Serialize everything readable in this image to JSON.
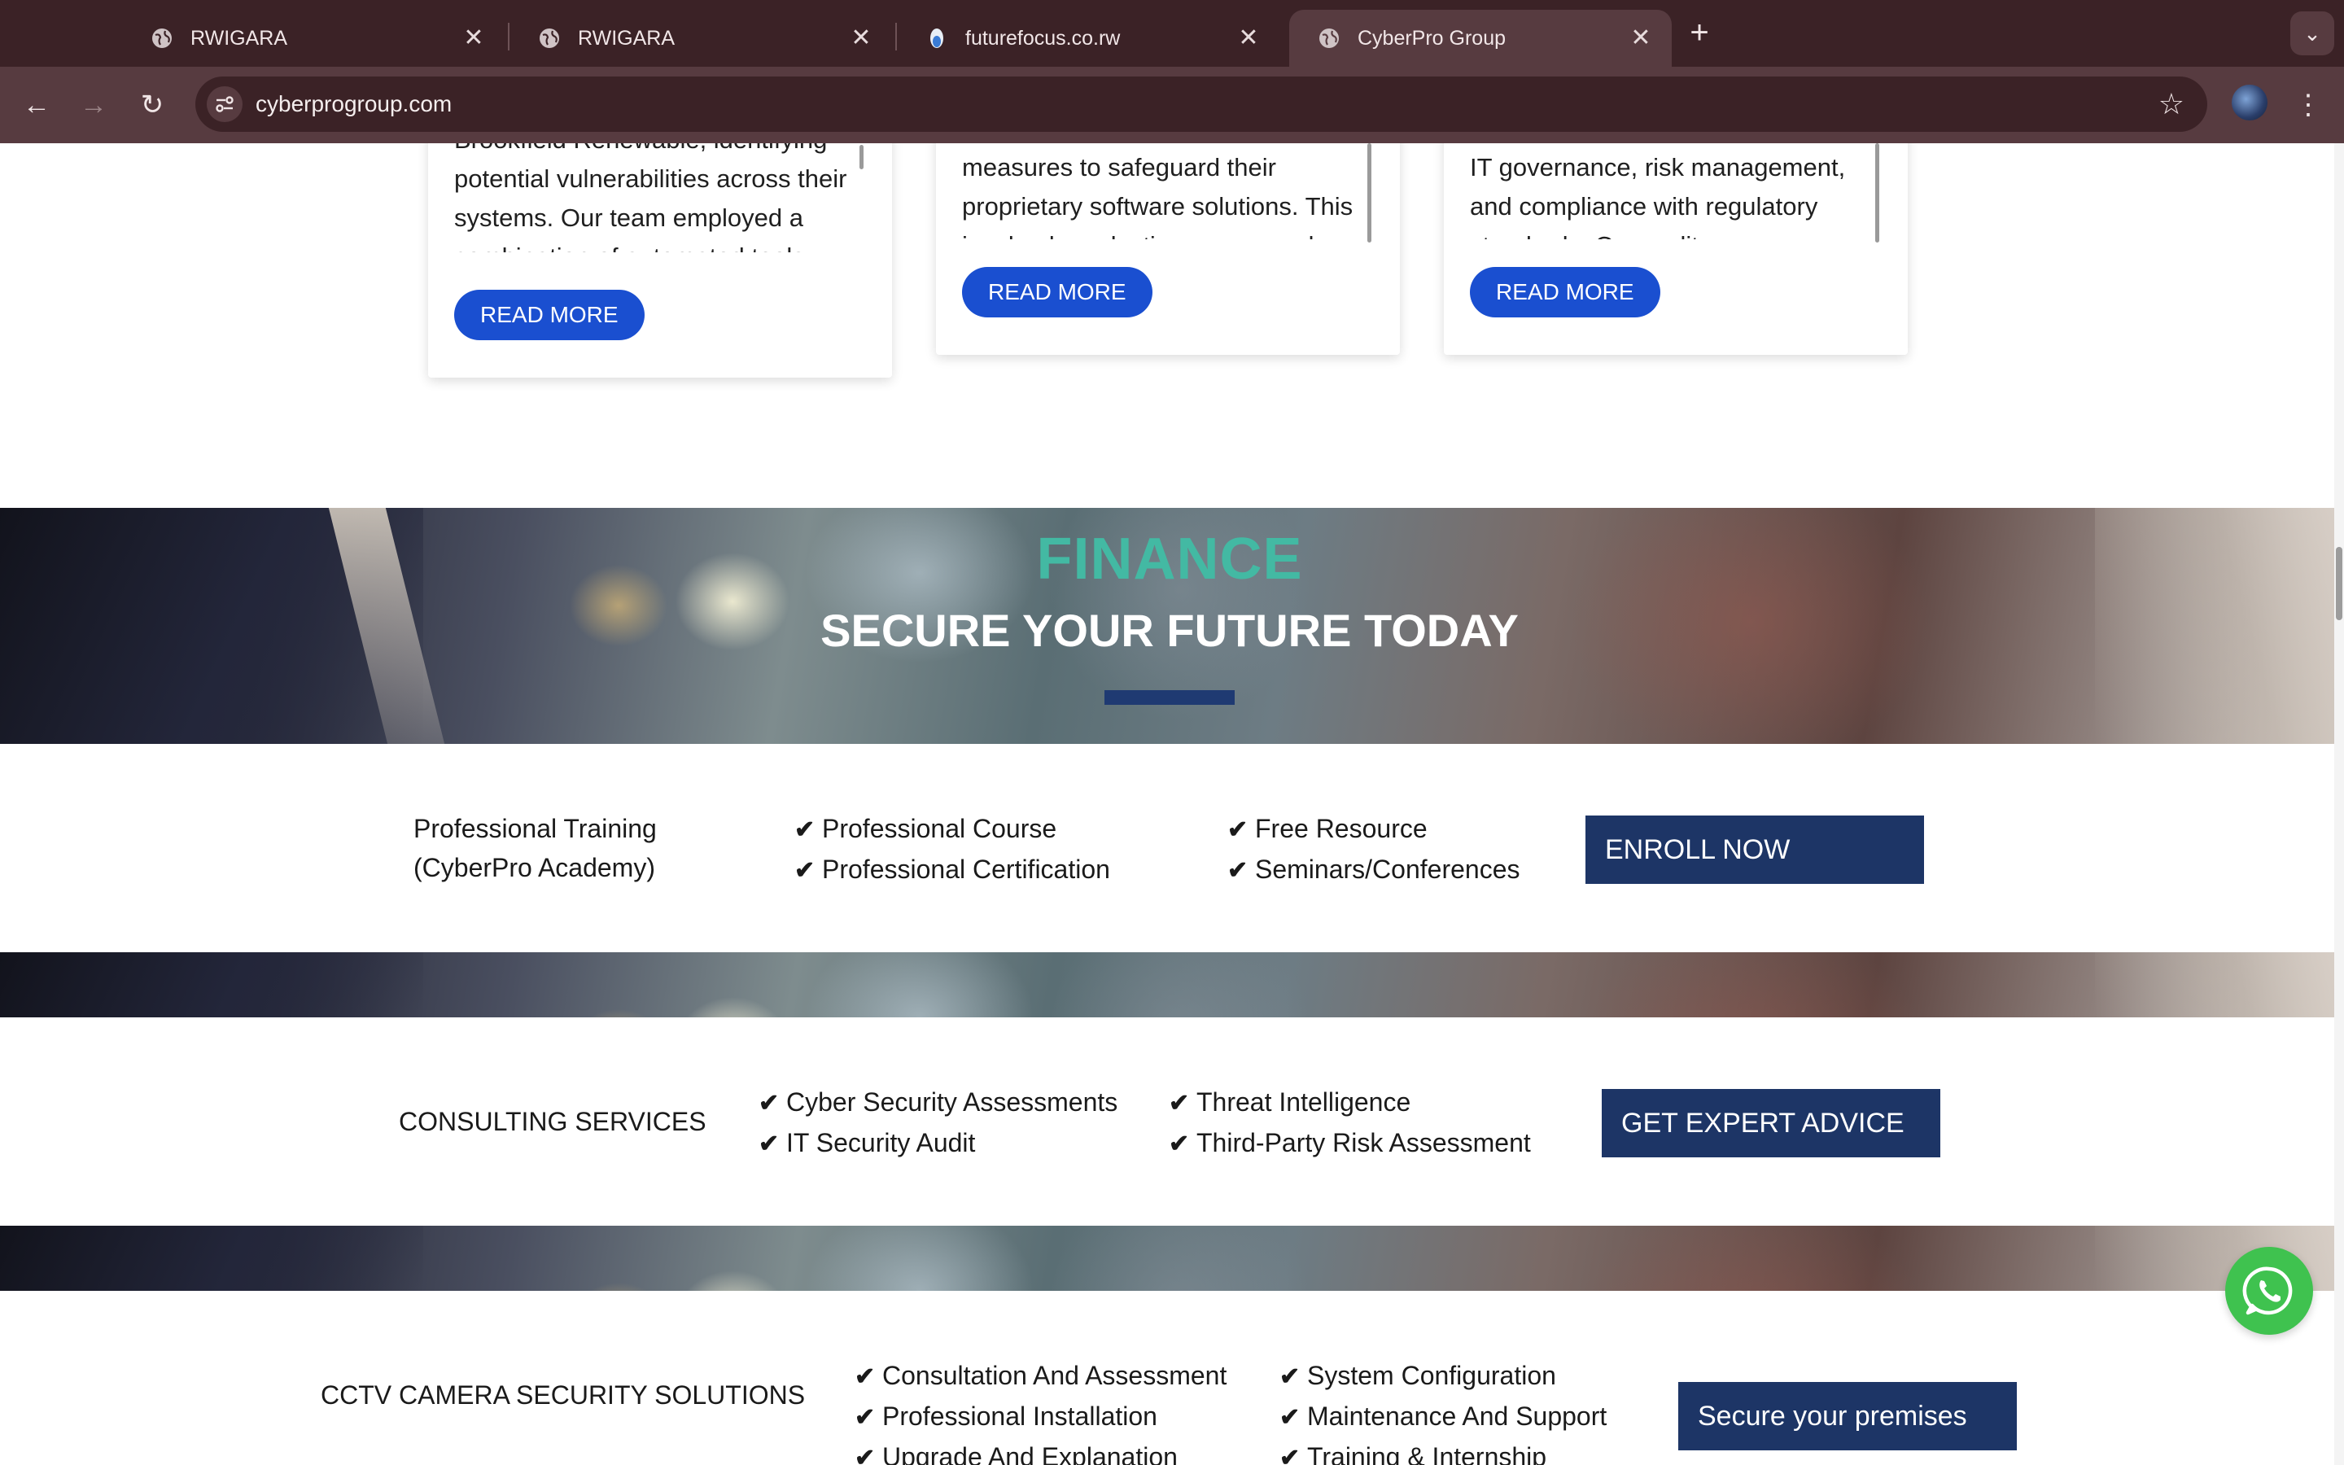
{
  "browser": {
    "tabs": [
      {
        "title": "RWIGARA",
        "favicon": "globe-icon",
        "close": "✕"
      },
      {
        "title": "RWIGARA",
        "favicon": "globe-icon",
        "close": "✕"
      },
      {
        "title": "futurefocus.co.rw",
        "favicon": "futurefocus-favicon",
        "close": "✕"
      },
      {
        "title": "CyberPro Group",
        "favicon": "globe-icon",
        "close": "✕"
      }
    ],
    "new_tab": "+",
    "tab_menu": "⌄",
    "url": "cyberprogroup.com",
    "back": "←",
    "forward": "→",
    "reload": "↻",
    "bookmark": "☆",
    "menu": "⋮"
  },
  "cards": [
    {
      "text": "cybersecurity assessment for Brookfield Renewable, identifying potential vulnerabilities across their systems. Our team employed a combination of automated tools",
      "button": "READ MORE"
    },
    {
      "text": "measures to safeguard their proprietary software solutions. This involved conducting secure code reviews and vulnerability",
      "button": "READ MORE"
    },
    {
      "text": "IT governance, risk management, and compliance with regulatory standards. Our audit process highlighted areas of",
      "button": "READ MORE"
    }
  ],
  "finance": {
    "title": "FINANCE",
    "subtitle": "SECURE YOUR FUTURE TODAY"
  },
  "training": {
    "label_line1": "Professional Training",
    "label_line2": "(CyberPro Academy)",
    "col1": [
      "Professional Course",
      "Professional Certification"
    ],
    "col2": [
      "Free Resource",
      "Seminars/Conferences"
    ],
    "cta": "ENROLL NOW"
  },
  "consulting": {
    "label": "CONSULTING SERVICES",
    "col1": [
      "Cyber Security Assessments",
      "IT Security Audit"
    ],
    "col2": [
      "Threat Intelligence",
      "Third-Party Risk Assessment"
    ],
    "cta": "GET EXPERT ADVICE"
  },
  "cctv": {
    "label": "CCTV CAMERA SECURITY SOLUTIONS",
    "col1": [
      "Consultation And Assessment",
      "Professional Installation",
      "Upgrade And Explanation"
    ],
    "col2": [
      "System Configuration",
      "Maintenance And Support",
      "Training & Internship"
    ],
    "cta": "Secure your premises"
  },
  "check_glyph": "✔",
  "colors": {
    "chrome_dark": "#3b2226",
    "chrome_light": "#573b40",
    "read_more_blue": "#1a4fd0",
    "finance_teal": "#43b9a3",
    "cta_navy": "#1d3566",
    "whatsapp_green": "#3fc24f"
  }
}
